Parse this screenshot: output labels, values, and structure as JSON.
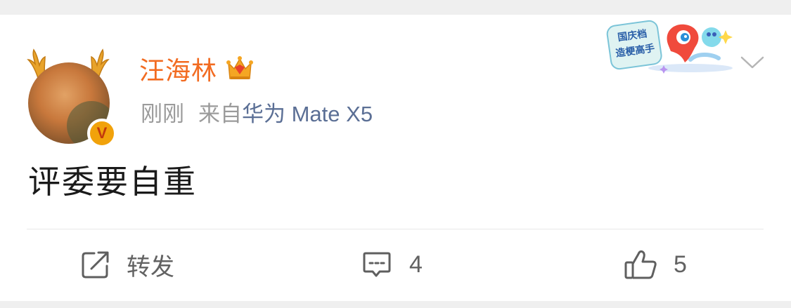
{
  "post": {
    "author": "汪海林",
    "time": "刚刚",
    "source_prefix": "来自",
    "source_device": "华为 Mate X5",
    "content": "评委要自重"
  },
  "badge": {
    "verified_letter": "V"
  },
  "banner": {
    "line1": "国庆档",
    "line2": "造梗高手"
  },
  "actions": {
    "repost_label": "转发",
    "comment_count": "4",
    "like_count": "5"
  },
  "icons": {
    "antlers": "antlers-icon",
    "crown": "crown-icon",
    "verified": "verified-badge-icon",
    "more": "chevron-down-icon",
    "repost": "share-icon",
    "comment": "comment-icon",
    "like": "thumbs-up-icon"
  },
  "colors": {
    "username": "#f26b21",
    "device_link": "#5b6f95",
    "meta_text": "#9b9b9b",
    "background": "#efefef",
    "card": "#ffffff"
  }
}
